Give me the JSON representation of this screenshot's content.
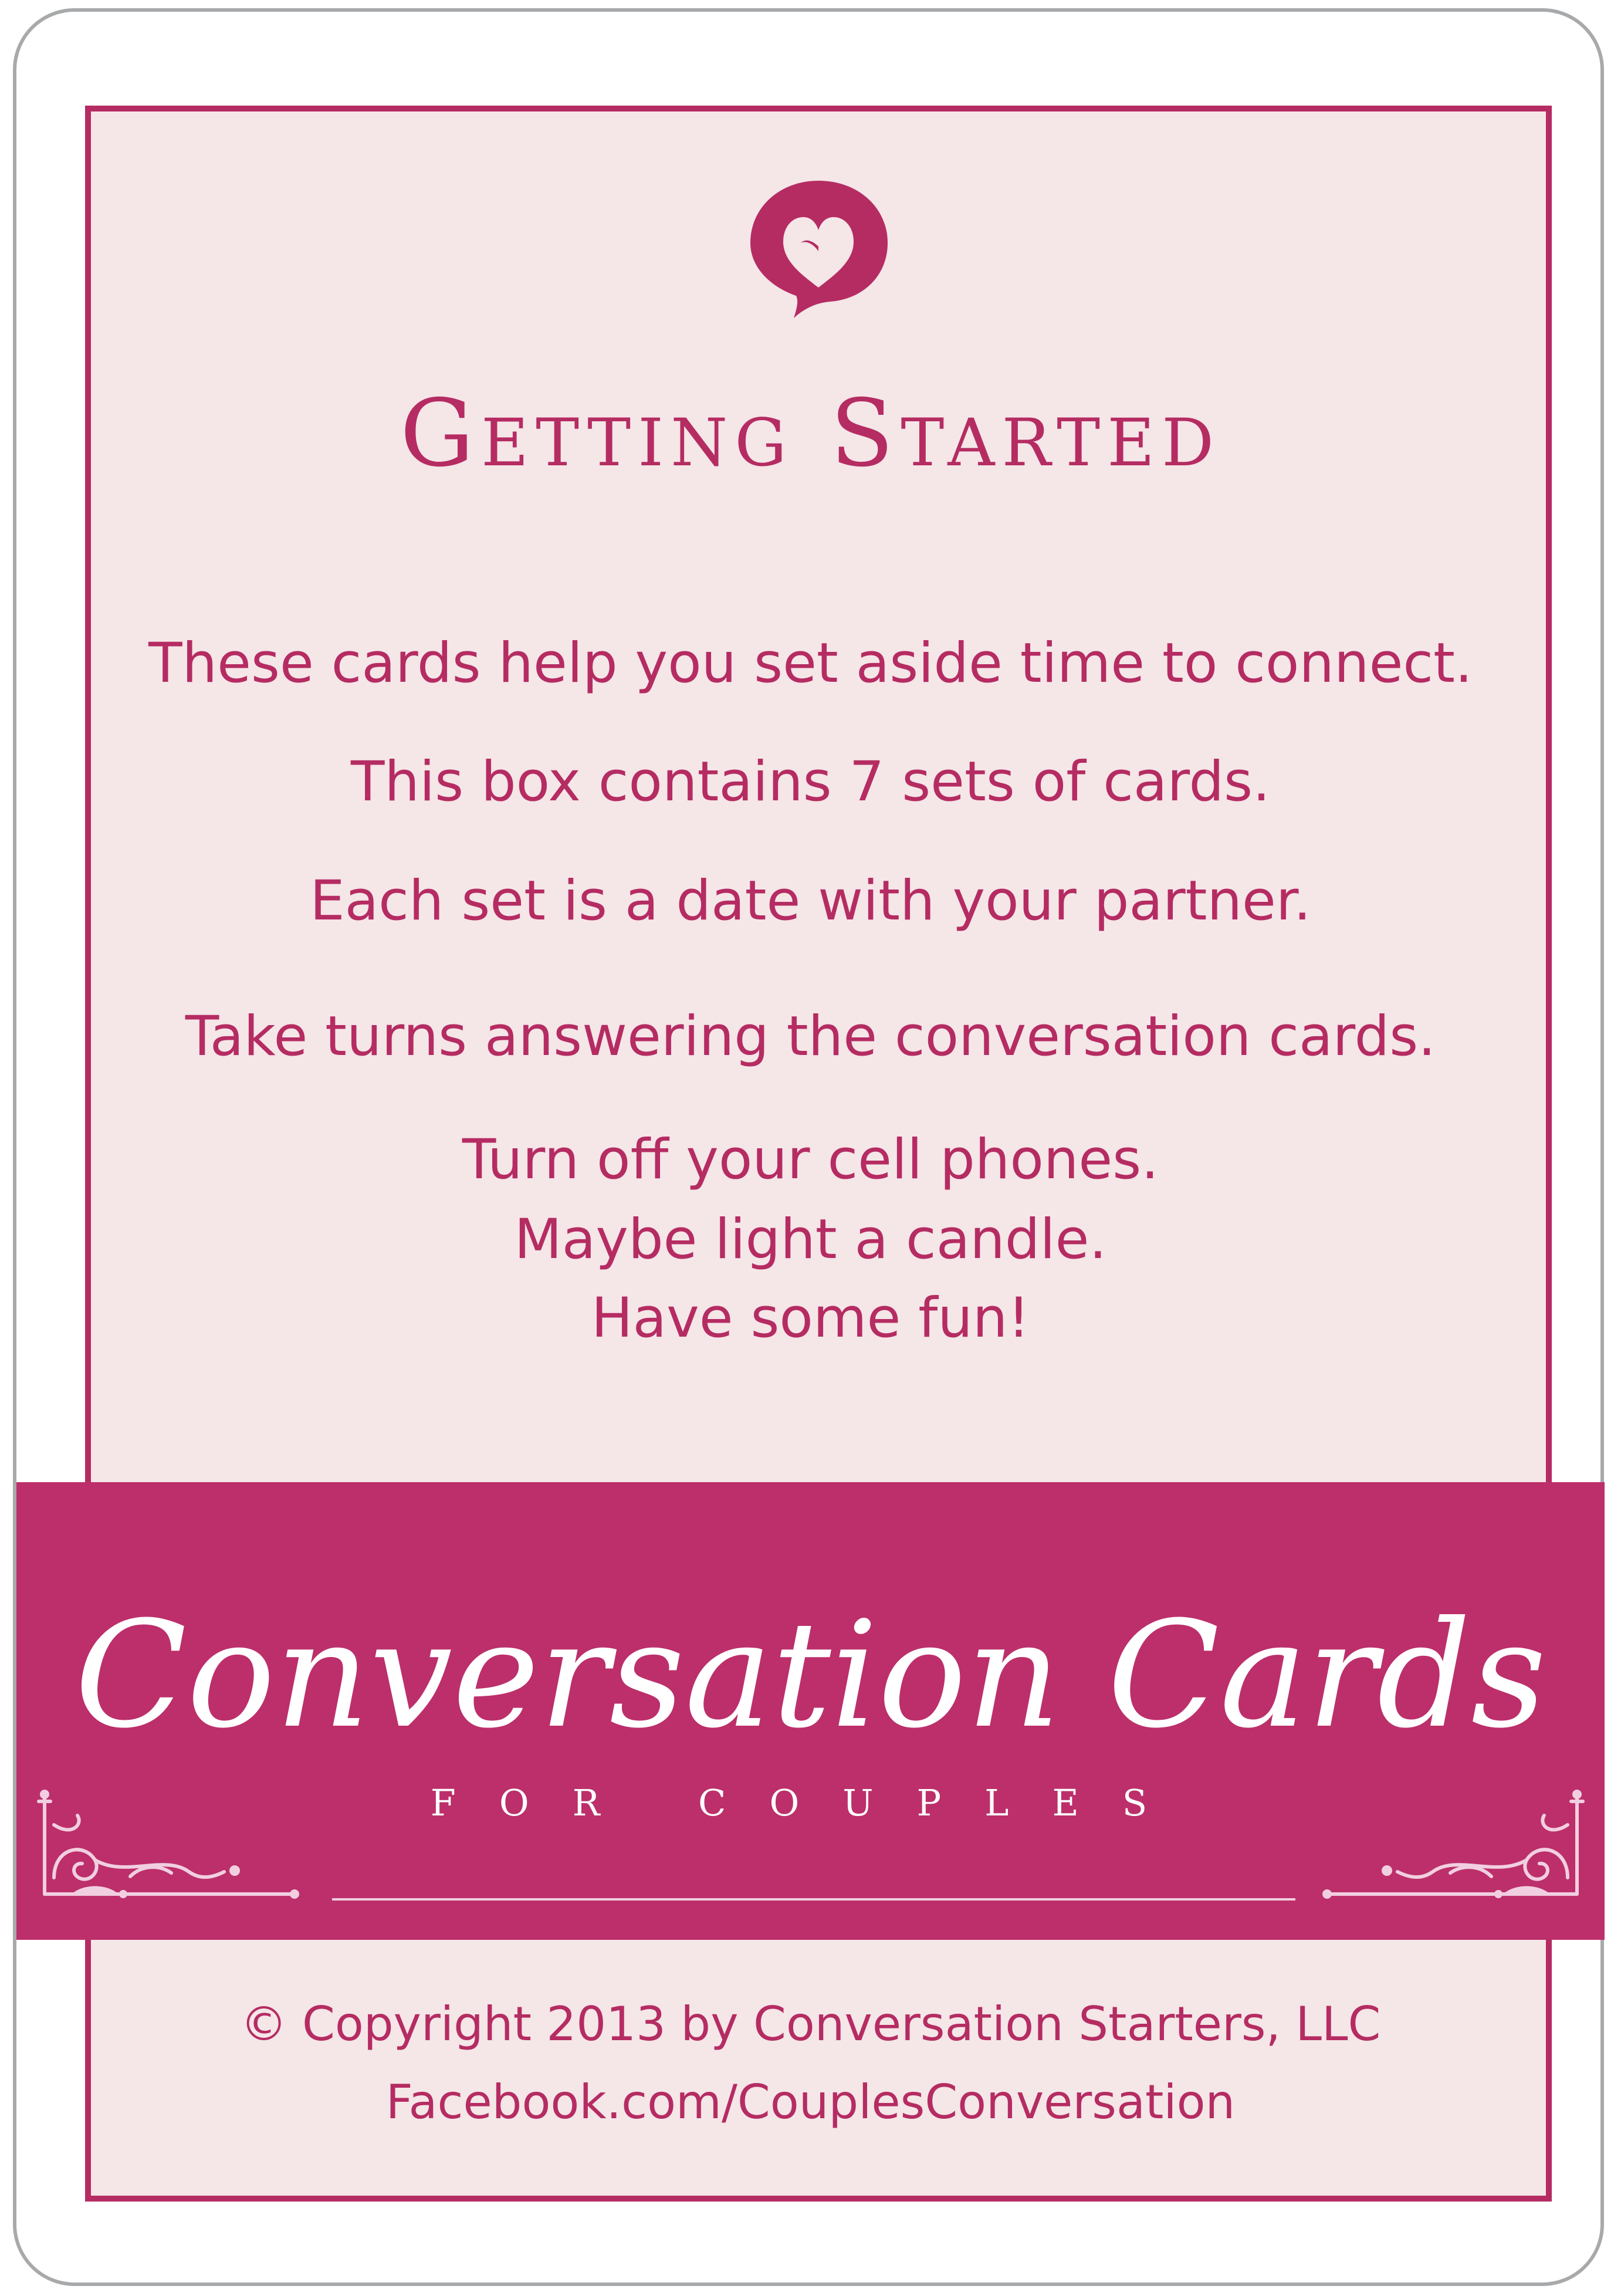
{
  "card": {
    "title": "Getting Started",
    "intro_lines": [
      "These cards help you set aside time to connect.",
      "This box contains 7 sets of cards.",
      "Each set is a date with your partner.",
      "Take turns answering the conversation cards."
    ],
    "closing_lines": [
      "Turn off your cell phones.",
      "Maybe light a candle.",
      "Have some fun!"
    ]
  },
  "band": {
    "brand_name": "Conversation Cards",
    "brand_subtitle": "FOR COUPLES"
  },
  "footer": {
    "copyright": "© Copyright 2013 by Conversation Starters, LLC",
    "social": "Facebook.com/CouplesConversation"
  },
  "icons": {
    "logo": "heart-speech-bubble-icon",
    "ornament_left": "flourish-ornament-icon",
    "ornament_right": "flourish-ornament-icon"
  },
  "colors": {
    "accent": "#b52c62",
    "band": "#bc2f6a",
    "panel": "#f5e6e8",
    "border_gray": "#a7a9ab"
  }
}
